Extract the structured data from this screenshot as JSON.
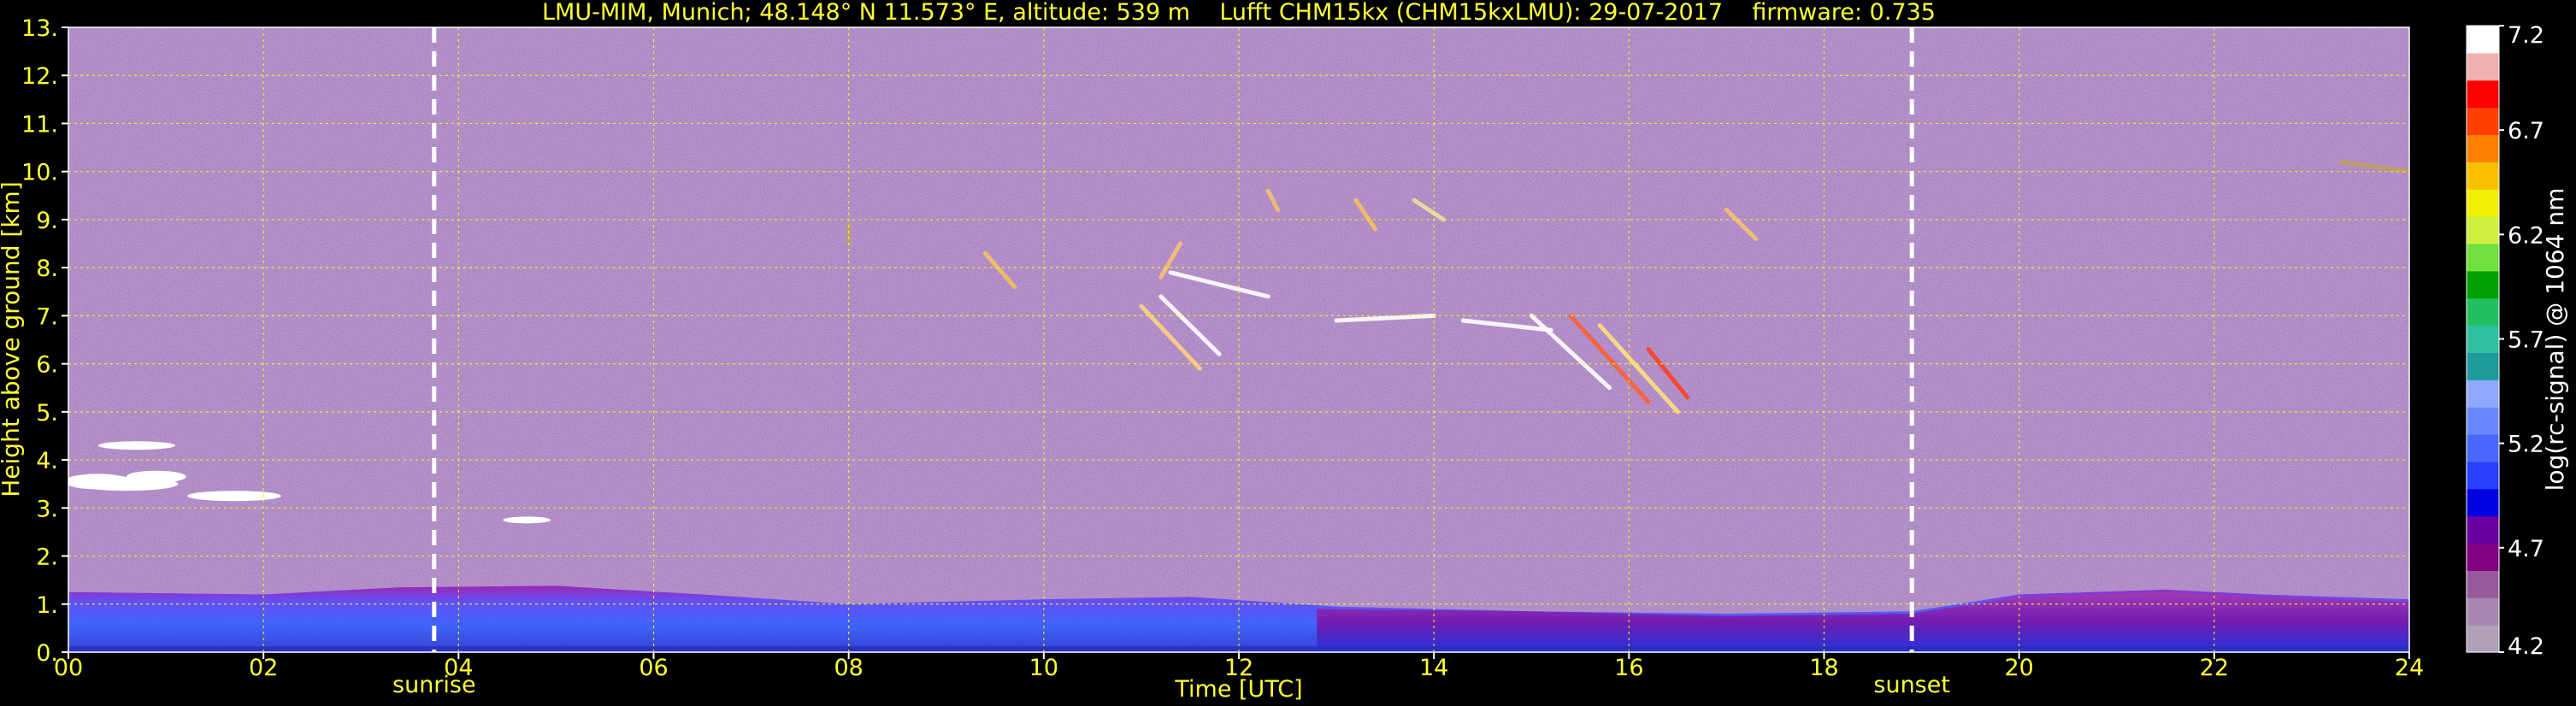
{
  "chart_data": {
    "type": "heatmap",
    "title": "LMU-MIM, Munich; 48.148° N 11.573° E, altitude: 539 m    Lufft CHM15kx (CHM15kxLMU): 29-07-2017    firmware: 0.735",
    "xlabel": "Time [UTC]",
    "ylabel": "Height above ground [km]",
    "xlim": [
      0,
      24
    ],
    "ylim": [
      0,
      13
    ],
    "xticks": [
      "00",
      "02",
      "04",
      "06",
      "08",
      "10",
      "12",
      "14",
      "16",
      "18",
      "20",
      "22",
      "24"
    ],
    "xtick_values": [
      0,
      2,
      4,
      6,
      8,
      10,
      12,
      14,
      16,
      18,
      20,
      22,
      24
    ],
    "yticks": [
      "0.",
      "1.",
      "2.",
      "3.",
      "4.",
      "5.",
      "6.",
      "7.",
      "8.",
      "9.",
      "10.",
      "11.",
      "12.",
      "13."
    ],
    "ytick_values": [
      0,
      1,
      2,
      3,
      4,
      5,
      6,
      7,
      8,
      9,
      10,
      11,
      12,
      13
    ],
    "grid": true,
    "grid_color": "#ffff00",
    "markers": [
      {
        "label": "sunrise",
        "time": 3.75
      },
      {
        "label": "sunset",
        "time": 18.9
      }
    ],
    "colorbar": {
      "label": "log(rc-signal) @ 1064 nm",
      "ticks": [
        "7.2",
        "6.7",
        "6.2",
        "5.7",
        "5.2",
        "4.7",
        "4.2"
      ],
      "tick_values": [
        7.2,
        6.7,
        6.2,
        5.7,
        5.2,
        4.7,
        4.2
      ],
      "range": [
        4.2,
        7.2
      ],
      "colors": [
        "#b0a0b8",
        "#a888b0",
        "#98589c",
        "#800080",
        "#6a00a0",
        "#0000e0",
        "#2840ff",
        "#4a68ff",
        "#6c88ff",
        "#90a8ff",
        "#1e9a9a",
        "#30c0a0",
        "#20c060",
        "#00a000",
        "#70e040",
        "#d0f040",
        "#f0f000",
        "#f8c000",
        "#ff8000",
        "#ff4000",
        "#ff0000",
        "#f0b0b0",
        "#ffffff"
      ]
    },
    "features": [
      {
        "name": "boundary layer",
        "t_start": 0,
        "t_end": 24,
        "h_top_km": 1.3,
        "signal": "high"
      },
      {
        "name": "low cloud",
        "t_start": 0,
        "t_end": 2,
        "h_km": 3.5
      },
      {
        "name": "cirrus",
        "t_start": 11,
        "t_end": 17.5,
        "h_min_km": 5,
        "h_max_km": 9.5
      }
    ],
    "background": "#000000"
  }
}
